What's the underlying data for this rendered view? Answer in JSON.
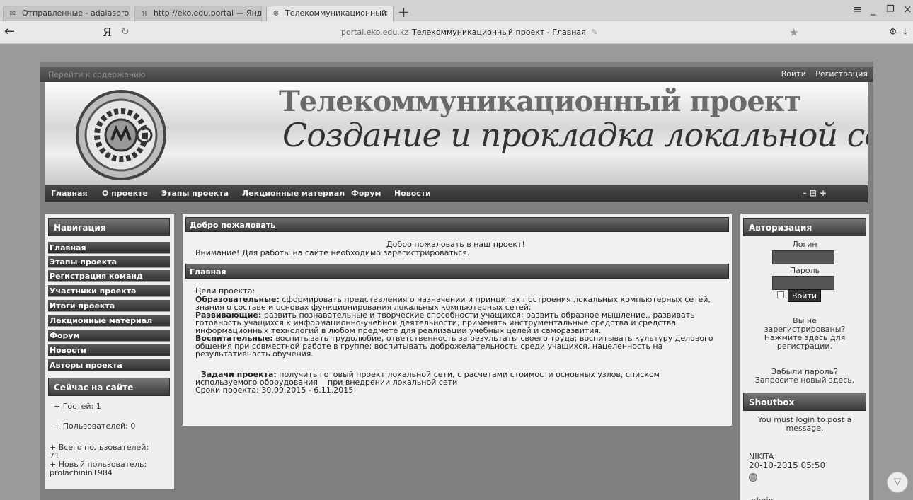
{
  "browser": {
    "tabs": [
      {
        "label": "Отправленные - adalasprom",
        "icon": "mail-icon"
      },
      {
        "label": "http://eko.edu.portal — Янде",
        "icon": "yandex-icon"
      },
      {
        "label": "Телекоммуникационный",
        "icon": "loading-icon"
      }
    ],
    "new_tab": "+",
    "logo": "Я",
    "url_domain": "portal.eko.edu.kz",
    "url_title": "Телекоммуникационный проект - Главная"
  },
  "header": {
    "skip_link": "Перейти к содержанию",
    "login": "Войти",
    "register": "Регистрация",
    "banner_title": "Телекоммуникационный проект",
    "banner_subtitle": "Создание и прокладка локальной сети"
  },
  "menu": {
    "items": [
      "Главная",
      "О проекте",
      "Этапы проекта",
      "Лекционные материал",
      "Форум",
      "Новости"
    ],
    "controls": "- ⊟ +"
  },
  "sidebar": {
    "nav_title": "Навигация",
    "nav_items": [
      "Главная",
      "Этапы проекта",
      "Регистрация команд",
      "Участники проекта",
      "Итоги проекта",
      "Лекционные материал",
      "Форум",
      "Новости",
      "Авторы проекта"
    ],
    "online_title": "Сейчас на сайте",
    "guests": "+ Гостей: 1",
    "users": "+ Пользователей: 0",
    "total_users_label": "+ Всего пользователей:",
    "total_users": "71",
    "new_user_label": "+ Новый пользователь:",
    "new_user": "prolachinin1984"
  },
  "main": {
    "welcome_title": "Добро пожаловать",
    "welcome_text": "Добро пожаловать в наш проект!",
    "warning": "Внимание! Для работы на сайте необходимо зарегистрироваться.",
    "section_title": "Главная",
    "goals_label": "Цели проекта:",
    "edu_label": "Образовательные:",
    "edu_text1": "сформировать представления о назначении и принципах построения локальных компьютерных сетей,",
    "edu_text2": "знания о составе и основах функционирования локальных компьютерных сетей;",
    "dev_label": "Развивающие:",
    "dev_text1": "развить познавательные и творческие способности учащихся; развить образное мышление., развивать",
    "dev_text2": "готовность учащихся к информационно-учебной деятельности, применять инструментальные средства и средства",
    "dev_text3": "информационных технологий в любом предмете для реализации учебных целей и саморазвития.",
    "upb_label": "Воспитательные:",
    "upb_text1": "воспитывать трудолюбие, ответственность за результаты своего труда; воспитывать культуру делового",
    "upb_text2": "общения при совместной работе в группе; воспитывать доброжелательность среди учащихся, нацеленность на",
    "upb_text3": "результативность обучения.",
    "tasks_label": "Задачи проекта:",
    "tasks_text1": "получить готовый проект локальной сети, с расчетами стоимости основных узлов, списком",
    "tasks_text2": "используемого оборудования    при внедрении локальной сети",
    "dates": "Сроки проекта: 30.09.2015 - 6.11.2015"
  },
  "auth": {
    "title": "Авторизация",
    "login_label": "Логин",
    "password_label": "Пароль",
    "login_button": "Войти",
    "not_registered1": "Вы не",
    "not_registered2": "зарегистрированы?",
    "not_registered3": "Нажмите здесь для",
    "not_registered4": "регистрации.",
    "forgot1": "Забыли пароль?",
    "forgot2": "Запросите новый здесь."
  },
  "shoutbox": {
    "title": "Shoutbox",
    "notice1": "You must login to post a",
    "notice2": "message.",
    "entries": [
      {
        "author": "NIKITA",
        "date": "20-10-2015 05:50"
      },
      {
        "author": "admin"
      }
    ]
  }
}
